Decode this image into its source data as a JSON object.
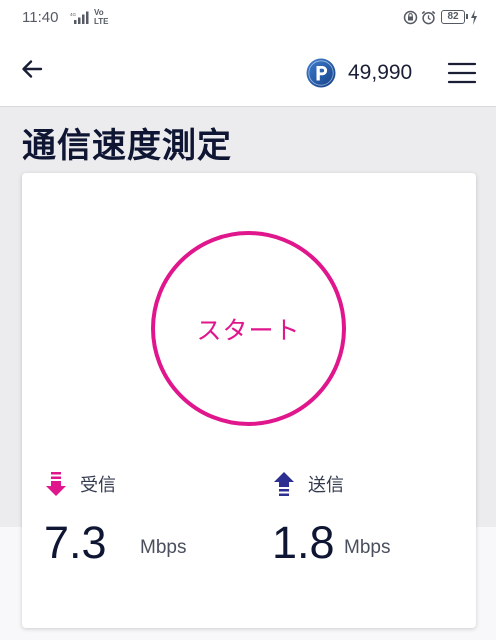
{
  "status_bar": {
    "time": "11:40",
    "network_label": "Vo\nLTE",
    "battery_level": "82"
  },
  "header": {
    "points_value": "49,990",
    "points_icon": "p-coin-icon",
    "back_icon": "back-arrow-icon",
    "menu_icon": "hamburger-menu-icon"
  },
  "page": {
    "title": "通信速度測定"
  },
  "speed_test": {
    "start_label": "スタート",
    "download": {
      "label": "受信",
      "value": "7.3",
      "unit": "Mbps"
    },
    "upload": {
      "label": "送信",
      "value": "1.8",
      "unit": "Mbps"
    }
  },
  "colors": {
    "accent": "#e0168d",
    "download_arrow": "#e0168d",
    "upload_arrow": "#2d3090",
    "title": "#0f1633",
    "points_icon": "#1c4f9c"
  }
}
